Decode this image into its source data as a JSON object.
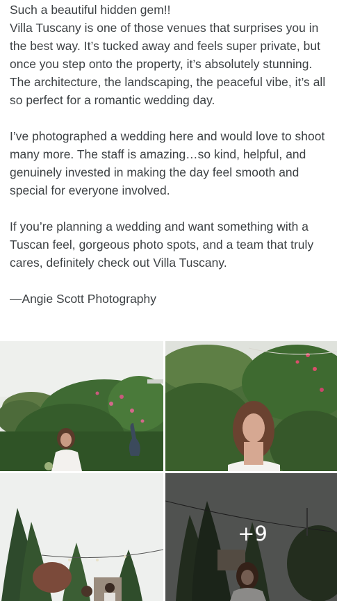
{
  "review": {
    "paragraphs": [
      "Such a beautiful hidden gem!!\nVilla Tuscany is one of those venues that surprises you in the best way. It’s tucked away and feels super private, but once you step onto the property, it’s absolutely stunning. The architecture, the landscaping, the peaceful vibe, it’s all so perfect for a romantic wedding day.",
      "I’ve photographed a wedding here and would love to shoot many more. The staff is amazing…so kind, helpful, and genuinely invested in making the day feel smooth and special for everyone involved.",
      "If you’re planning a wedding and want something with a Tuscan feel, gorgeous photo spots, and a team that truly cares, definitely check out Villa Tuscany.",
      "—Angie Scott Photography"
    ]
  },
  "photos": {
    "items": [
      {
        "description": "bride-in-garden-with-heron-statue"
      },
      {
        "description": "bride-portrait-greenery"
      },
      {
        "description": "tall-cypress-trees-string-lights"
      },
      {
        "description": "bride-dusk-string-lights"
      }
    ],
    "more_count_label": "+9"
  }
}
